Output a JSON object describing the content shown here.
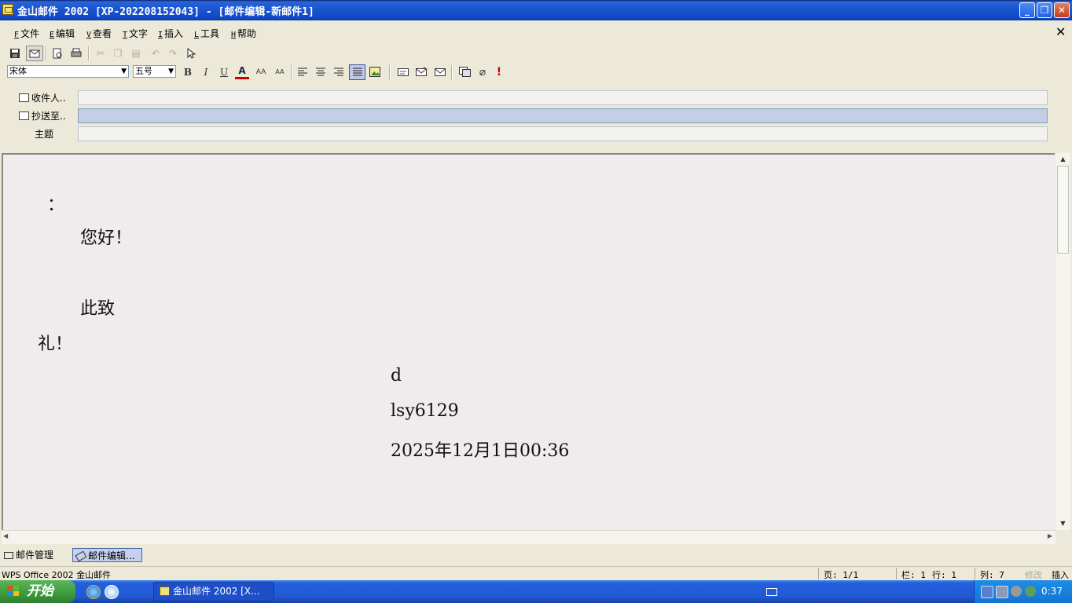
{
  "window": {
    "title": "金山邮件 2002 [XP-202208152043] - [邮件编辑-新邮件1]",
    "controls": {
      "minimize": "_",
      "maximize": "❐",
      "close": "✕"
    }
  },
  "menu": [
    {
      "key": "F",
      "label": "文件"
    },
    {
      "key": "E",
      "label": "编辑"
    },
    {
      "key": "V",
      "label": "查看"
    },
    {
      "key": "T",
      "label": "文字"
    },
    {
      "key": "I",
      "label": "插入"
    },
    {
      "key": "L",
      "label": "工具"
    },
    {
      "key": "H",
      "label": "帮助"
    }
  ],
  "menu_close": "✕",
  "format": {
    "font": "宋体",
    "size": "五号",
    "bold": "B",
    "italic": "I",
    "underline": "U",
    "font_color": "A",
    "grow_font": "AA",
    "shrink_font": "AA"
  },
  "address": {
    "to_label": "收件人..",
    "cc_label": "抄送至..",
    "subject_label": "主题",
    "to_value": "",
    "cc_value": "",
    "subject_value": ""
  },
  "body": {
    "colon": "：",
    "greeting": "您好！",
    "closing1": "此致",
    "closing2": "礼！",
    "sig_name": "d",
    "sig_id": "lsy6129",
    "sig_date": "2025年12月1日00:36"
  },
  "view_tabs": {
    "manage": "邮件管理",
    "edit": "邮件编辑..."
  },
  "status": {
    "app": "WPS Office 2002 金山邮件",
    "page": "页: 1/1",
    "column_bar": "栏: 1",
    "row": "行: 1",
    "col": "列: 7",
    "modify": "修改",
    "insert": "插入"
  },
  "taskbar": {
    "start": "开始",
    "task": "金山邮件 2002 [X...",
    "clock": "0:37"
  },
  "colors": {
    "titlebar": "#1c57d4",
    "chrome": "#ece9d8",
    "editor_bg": "#f0ecee",
    "cc_focus": "#c4cee6",
    "start_green": "#3c9a3c"
  }
}
